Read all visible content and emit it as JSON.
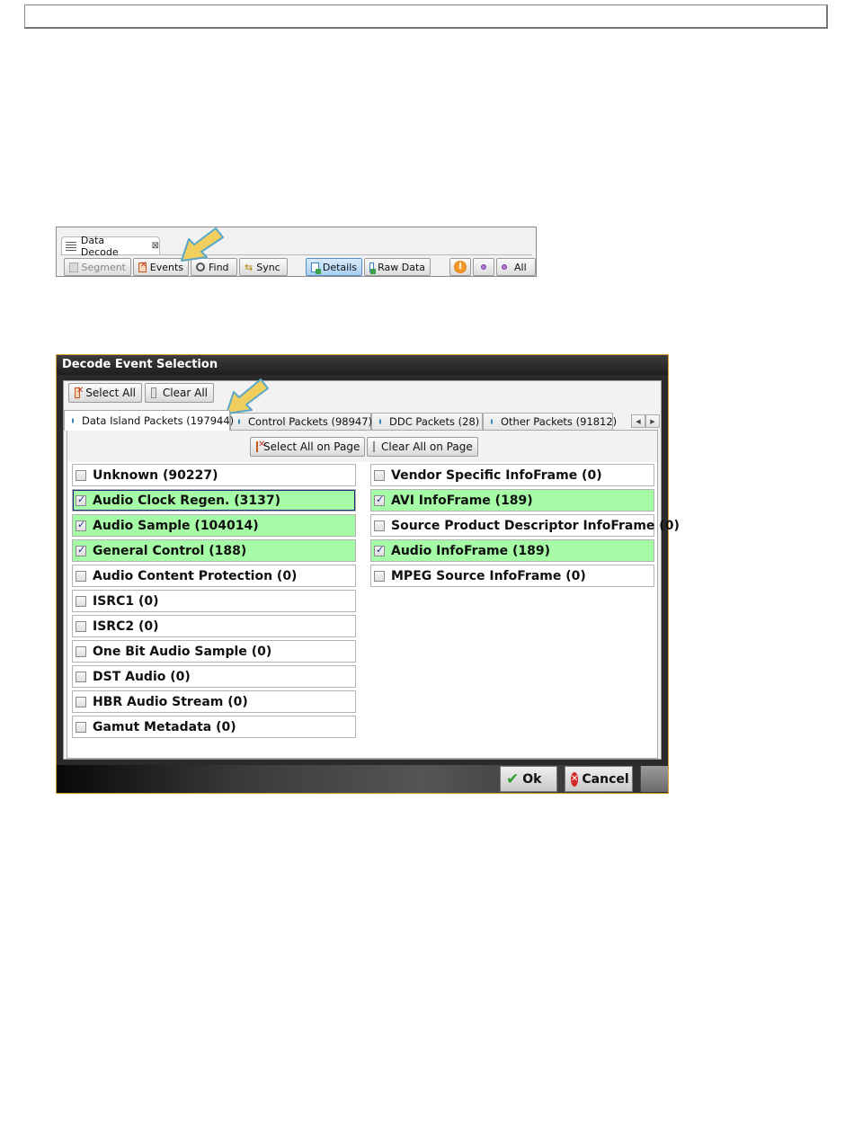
{
  "toolbar": {
    "tab_label": "Data Decode",
    "tab_close": "⊠",
    "buttons": {
      "segment": "Segment",
      "events": "Events",
      "find": "Find",
      "sync": "Sync",
      "details": "Details",
      "raw_data": "Raw Data",
      "warn_glyph": "!",
      "all": "All"
    }
  },
  "dialog": {
    "title": "Decode Event Selection",
    "select_all": "Select All",
    "clear_all": "Clear All",
    "tabs": [
      {
        "label": "Data Island Packets (197944)"
      },
      {
        "label": "Control Packets (98947)"
      },
      {
        "label": "DDC Packets (28)"
      },
      {
        "label": "Other Packets (91812)"
      }
    ],
    "scroll_left": "◀",
    "scroll_right": "▶",
    "select_all_page": "Select All on Page",
    "clear_all_page": "Clear All on Page",
    "left_items": [
      {
        "label": "Unknown (90227)",
        "checked": false
      },
      {
        "label": "Audio Clock Regen. (3137)",
        "checked": true
      },
      {
        "label": "Audio Sample (104014)",
        "checked": true
      },
      {
        "label": "General Control (188)",
        "checked": true
      },
      {
        "label": "Audio Content Protection (0)",
        "checked": false
      },
      {
        "label": "ISRC1 (0)",
        "checked": false
      },
      {
        "label": "ISRC2 (0)",
        "checked": false
      },
      {
        "label": "One Bit Audio Sample (0)",
        "checked": false
      },
      {
        "label": "DST Audio (0)",
        "checked": false
      },
      {
        "label": "HBR Audio Stream (0)",
        "checked": false
      },
      {
        "label": "Gamut Metadata (0)",
        "checked": false
      }
    ],
    "right_items": [
      {
        "label": "Vendor Specific InfoFrame (0)",
        "checked": false
      },
      {
        "label": "AVI InfoFrame (189)",
        "checked": true
      },
      {
        "label": "Source Product Descriptor InfoFrame (0)",
        "checked": false
      },
      {
        "label": "Audio InfoFrame (189)",
        "checked": true
      },
      {
        "label": "MPEG Source InfoFrame (0)",
        "checked": false
      }
    ],
    "ok": "Ok",
    "cancel": "Cancel"
  },
  "colors": {
    "checked_row": "#a6fca6",
    "arrow_fill": "#f0cf5e",
    "arrow_stroke": "#5aa7c9",
    "dialog_border": "#d9a03a"
  }
}
